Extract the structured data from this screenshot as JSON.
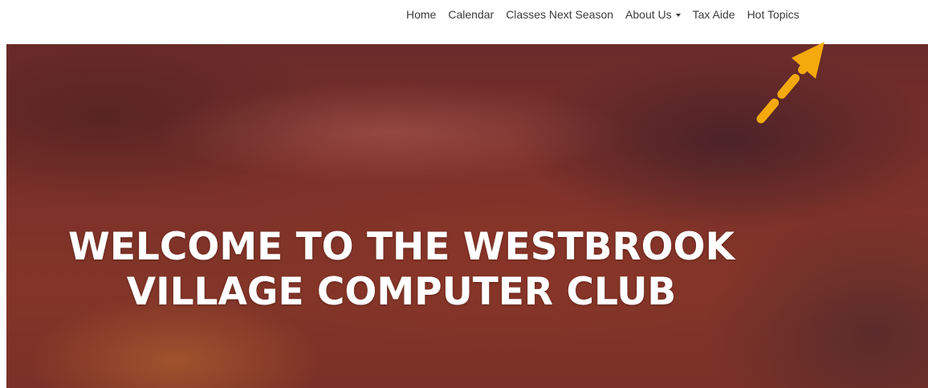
{
  "nav": {
    "items": [
      {
        "label": "Home"
      },
      {
        "label": "Calendar"
      },
      {
        "label": "Classes Next Season"
      },
      {
        "label": "About Us",
        "has_dropdown": true
      },
      {
        "label": "Tax Aide"
      },
      {
        "label": "Hot Topics"
      }
    ]
  },
  "hero": {
    "title_line_1": "WELCOME TO THE WESTBROOK",
    "title_line_2": "VILLAGE COMPUTER CLUB"
  },
  "annotation": {
    "arrow_color": "#f4a90c",
    "points_to": "Hot Topics"
  }
}
